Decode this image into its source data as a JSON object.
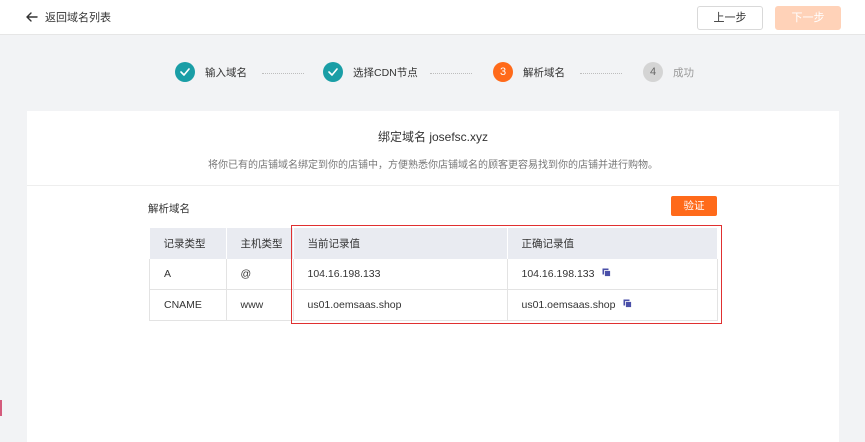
{
  "header": {
    "back_label": "返回域名列表",
    "prev_label": "上一步",
    "next_label": "下一步"
  },
  "steps": [
    {
      "label": "输入域名",
      "state": "done",
      "number": "1"
    },
    {
      "label": "选择CDN节点",
      "state": "done",
      "number": "2"
    },
    {
      "label": "解析域名",
      "state": "active",
      "number": "3"
    },
    {
      "label": "成功",
      "state": "todo",
      "number": "4"
    }
  ],
  "card": {
    "title": "绑定域名 josefsc.xyz",
    "description": "将你已有的店铺域名绑定到你的店铺中，方便熟悉你店铺域名的顾客更容易找到你的店铺并进行购物。",
    "section_label": "解析域名",
    "verify_label": "验证"
  },
  "table": {
    "headers": [
      "记录类型",
      "主机类型",
      "当前记录值",
      "正确记录值"
    ],
    "rows": [
      {
        "type": "A",
        "host": "@",
        "current": "104.16.198.133",
        "correct": "104.16.198.133"
      },
      {
        "type": "CNAME",
        "host": "www",
        "current": "us01.oemsaas.shop",
        "correct": "us01.oemsaas.shop"
      }
    ]
  },
  "colors": {
    "accent": "#ff6a1a",
    "done": "#1a9ea6",
    "highlight_border": "#e03030"
  },
  "icons": [
    "back-arrow-icon",
    "check-icon",
    "copy-icon"
  ]
}
